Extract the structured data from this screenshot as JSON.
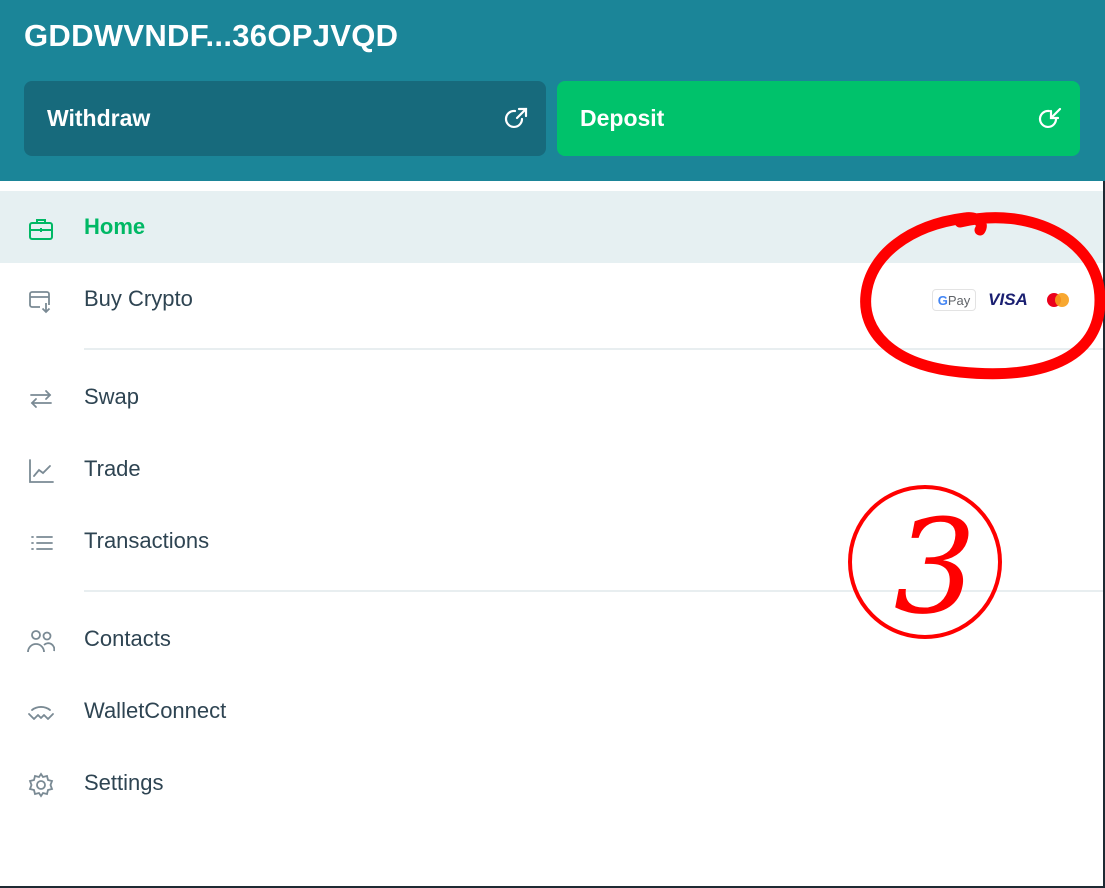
{
  "header": {
    "account_id": "GDDWVNDF...36OPJVQD",
    "withdraw_label": "Withdraw",
    "deposit_label": "Deposit"
  },
  "menu": {
    "items": [
      {
        "label": "Home",
        "icon": "briefcase-icon",
        "active": true
      },
      {
        "label": "Buy Crypto",
        "icon": "card-download-icon"
      },
      {
        "label": "Swap",
        "icon": "swap-arrows-icon"
      },
      {
        "label": "Trade",
        "icon": "chart-line-icon"
      },
      {
        "label": "Transactions",
        "icon": "list-icon"
      },
      {
        "label": "Contacts",
        "icon": "users-icon"
      },
      {
        "label": "WalletConnect",
        "icon": "walletconnect-icon"
      },
      {
        "label": "Settings",
        "icon": "gear-icon"
      }
    ]
  },
  "payment_badges": {
    "gpay_g": "G",
    "gpay_rest": " Pay",
    "visa": "VISA",
    "mastercard": "mastercard-logo"
  },
  "annotation": {
    "number": "3",
    "color": "#ff0000"
  },
  "colors": {
    "header_bg": "#1b8598",
    "withdraw_bg": "#176a7c",
    "deposit_bg": "#00c26b",
    "active_text": "#00b865",
    "active_bg": "#e6f0f2"
  }
}
